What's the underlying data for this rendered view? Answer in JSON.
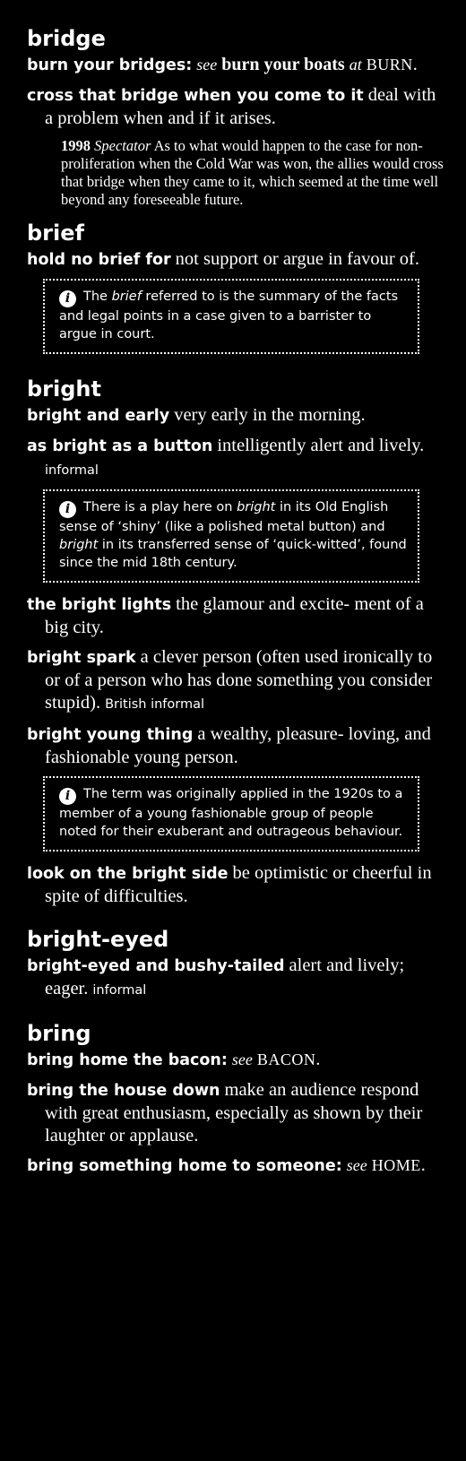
{
  "sections": {
    "bridge": {
      "headword": "bridge",
      "e1": {
        "phrase": "burn your bridges",
        "sep": ":",
        "see": "see",
        "ref": "burn your boats",
        "at": "at",
        "xref": "BURN",
        "end": "."
      },
      "e2": {
        "phrase": "cross that bridge when you come to it",
        "def": "deal with a problem when and if it arises."
      },
      "quote": {
        "year": "1998",
        "source": "Spectator",
        "text": "As to what would happen to the case for non-proliferation when the Cold War was won, the allies would cross that bridge when they came to it, which seemed at the time well beyond any foreseeable future."
      }
    },
    "brief": {
      "headword": "brief",
      "e1": {
        "phrase": "hold no brief for",
        "def": "not support or argue in favour of."
      },
      "note": {
        "pre": "The",
        "em": "brief",
        "post": "referred to is the summary of the facts and legal points in a case given to a barrister to argue in court."
      }
    },
    "bright": {
      "headword": "bright",
      "e1": {
        "phrase": "bright and early",
        "def": "very early in the morning."
      },
      "e2": {
        "phrase": "as bright as a button",
        "def": "intelligently alert and lively.",
        "reg": "informal"
      },
      "note1": {
        "p1": "There is a play here on",
        "em1": "bright",
        "p2": "in its Old English sense of ‘shiny’ (like a polished metal button) and",
        "em2": "bright",
        "p3": "in its transferred sense of ‘quick-witted’, found since the mid 18th century."
      },
      "e3": {
        "phrase": "the bright lights",
        "def": "the glamour and excite- ment of a big city."
      },
      "e4": {
        "phrase": "bright spark",
        "def": "a clever person (often used ironically to or of a person who has done something you consider stupid).",
        "reg": "British informal"
      },
      "e5": {
        "phrase": "bright young thing",
        "def": "a wealthy, pleasure- loving, and fashionable young person."
      },
      "note2": {
        "text": "The term was originally applied in the 1920s to a member of a young fashionable group of people noted for their exuberant and outrageous behaviour."
      },
      "e6": {
        "phrase": "look on the bright side",
        "def": "be optimistic or cheerful in spite of difficulties."
      }
    },
    "bright_eyed": {
      "headword": "bright-eyed",
      "e1": {
        "phrase": "bright-eyed and bushy-tailed",
        "def": "alert and lively; eager.",
        "reg": "informal"
      }
    },
    "bring": {
      "headword": "bring",
      "e1": {
        "phrase": "bring home the bacon",
        "sep": ":",
        "see": "see",
        "xref": "BACON",
        "end": "."
      },
      "e2": {
        "phrase": "bring the house down",
        "def": "make an audience respond with great enthusiasm, especially as shown by their laughter or applause."
      },
      "e3": {
        "phrase": "bring something home to someone",
        "sep": ":",
        "see": "see",
        "xref": "HOME",
        "end": "."
      }
    }
  },
  "icons": {
    "info": "info-icon",
    "info_glyph": "i"
  }
}
